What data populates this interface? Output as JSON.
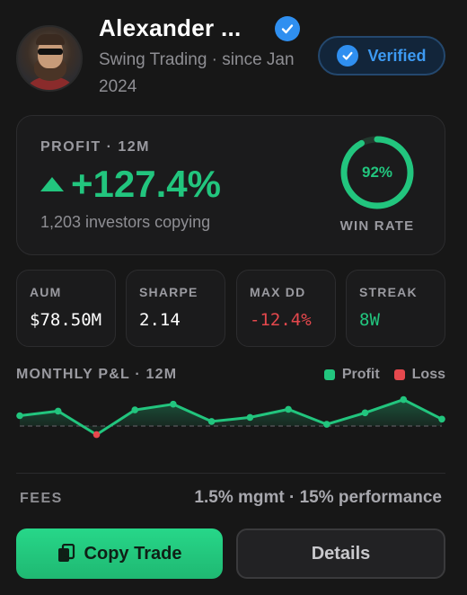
{
  "trader": {
    "name": "Alexander ...",
    "subtitle": "Swing Trading · since Jan 2024",
    "verified_label": "Verified"
  },
  "profit": {
    "label": "PROFIT · 12M",
    "value": "+127.4%",
    "investors": "1,203 investors copying",
    "win_rate_value": "92%",
    "win_rate_fraction": 0.92,
    "win_rate_label": "WIN RATE"
  },
  "stats": [
    {
      "label": "AUM",
      "value": "$78.50M",
      "color": "#ffffff"
    },
    {
      "label": "SHARPE",
      "value": "2.14",
      "color": "#ffffff"
    },
    {
      "label": "MAX DD",
      "value": "-12.4%",
      "color": "#e5484d"
    },
    {
      "label": "STREAK",
      "value": "8W",
      "color": "#22c57e"
    }
  ],
  "chart": {
    "title": "MONTHLY P&L · 12M",
    "legend": {
      "profit": "Profit",
      "loss": "Loss"
    }
  },
  "chart_data": {
    "type": "line",
    "values": [
      1.8,
      2.6,
      -1.5,
      2.8,
      3.8,
      0.8,
      1.5,
      2.9,
      0.3,
      2.3,
      4.6,
      1.2
    ],
    "series": [
      {
        "name": "Profit",
        "color": "#22c57e"
      },
      {
        "name": "Loss",
        "color": "#e5484d"
      }
    ],
    "baseline": 0
  },
  "fees": {
    "label": "FEES",
    "value": "1.5% mgmt · 15% performance"
  },
  "actions": {
    "copy_label": "Copy Trade",
    "details_label": "Details"
  },
  "colors": {
    "accent_green": "#22c57e",
    "accent_blue": "#2f8ff0",
    "loss_red": "#e5484d"
  }
}
